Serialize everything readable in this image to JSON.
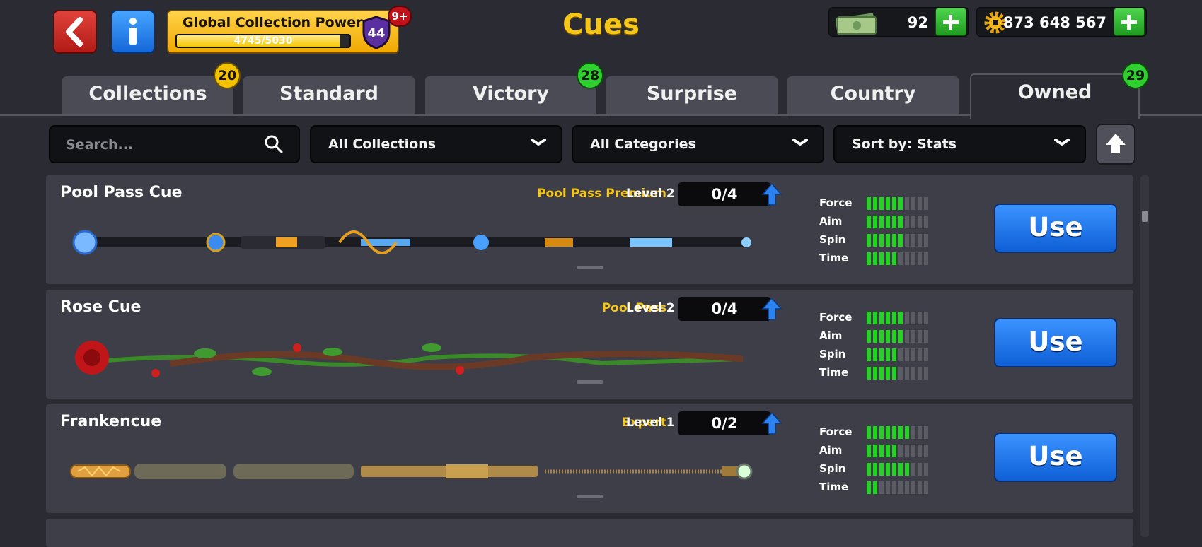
{
  "header": {
    "title": "Cues",
    "power_label": "Global Collection Power",
    "power_progress_text": "4745/5030",
    "power_progress_fraction": 0.943,
    "power_level": "44",
    "notification_badge": "9+",
    "cash": "92",
    "coins": "873 648 567"
  },
  "tabs": [
    {
      "label": "Collections",
      "badge": "20",
      "active": false
    },
    {
      "label": "Standard",
      "badge": "",
      "active": false
    },
    {
      "label": "Victory",
      "badge": "28",
      "active": false
    },
    {
      "label": "Surprise",
      "badge": "",
      "active": false
    },
    {
      "label": "Country",
      "badge": "",
      "active": false
    },
    {
      "label": "Owned",
      "badge": "29",
      "active": true
    }
  ],
  "filters": {
    "search_placeholder": "Search...",
    "collections": "All Collections",
    "categories": "All Categories",
    "sort": "Sort by: Stats"
  },
  "stat_labels": [
    "Force",
    "Aim",
    "Spin",
    "Time"
  ],
  "stat_max": 10,
  "cues": [
    {
      "name": "Pool Pass Cue",
      "tier": "Pool Pass Premium",
      "level": "Level 2",
      "progress": "0/4",
      "button": "Use",
      "stats": [
        6,
        6,
        6,
        5
      ]
    },
    {
      "name": "Rose Cue",
      "tier": "Pool Pass",
      "level": "Level 2",
      "progress": "0/4",
      "button": "Use",
      "stats": [
        6,
        6,
        5,
        5
      ]
    },
    {
      "name": "Frankencue",
      "tier": "Expert",
      "level": "Level 1",
      "progress": "0/2",
      "button": "Use",
      "stats": [
        7,
        5,
        7,
        2
      ]
    }
  ],
  "colors": {
    "accent_gold": "#f5c518",
    "stat_fill": "#22d322",
    "stat_empty": "#5a5b63",
    "use_button": "#1f74ea"
  }
}
